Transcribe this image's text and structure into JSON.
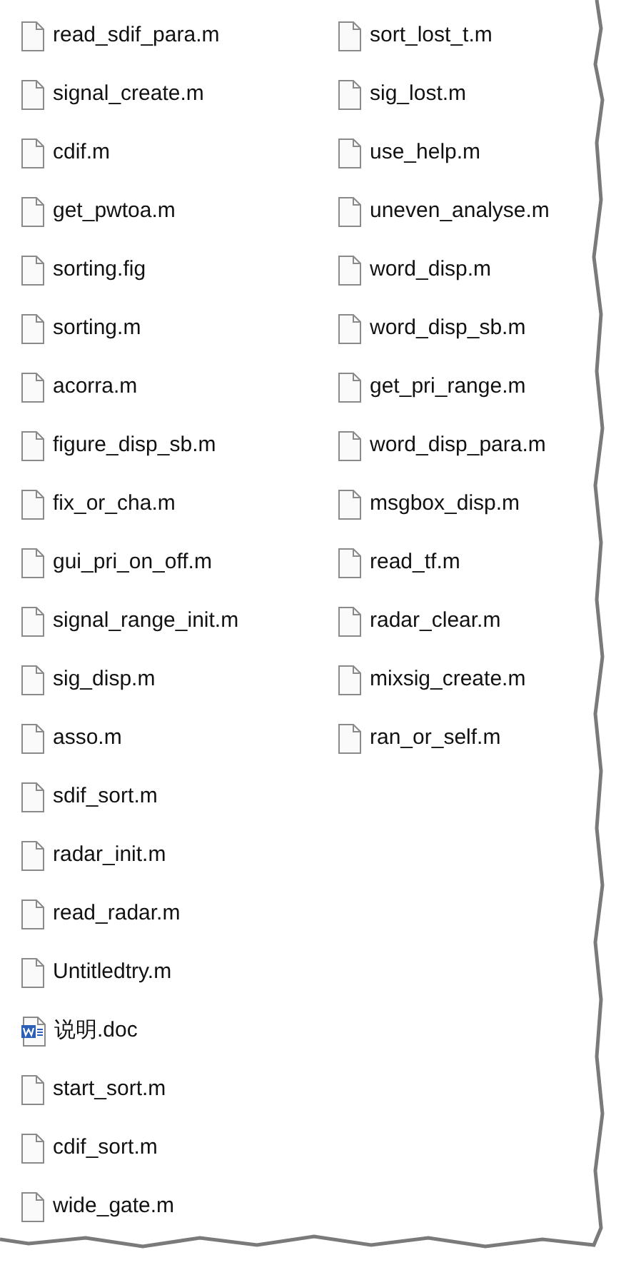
{
  "columns": [
    [
      {
        "name": "read_sdif_para.m",
        "kind": "file"
      },
      {
        "name": "signal_create.m",
        "kind": "file"
      },
      {
        "name": "cdif.m",
        "kind": "file"
      },
      {
        "name": "get_pwtoa.m",
        "kind": "file"
      },
      {
        "name": "sorting.fig",
        "kind": "file"
      },
      {
        "name": "sorting.m",
        "kind": "file"
      },
      {
        "name": "acorra.m",
        "kind": "file"
      },
      {
        "name": "figure_disp_sb.m",
        "kind": "file"
      },
      {
        "name": "fix_or_cha.m",
        "kind": "file"
      },
      {
        "name": "gui_pri_on_off.m",
        "kind": "file"
      },
      {
        "name": "signal_range_init.m",
        "kind": "file"
      },
      {
        "name": "sig_disp.m",
        "kind": "file"
      },
      {
        "name": "asso.m",
        "kind": "file"
      },
      {
        "name": "sdif_sort.m",
        "kind": "file"
      },
      {
        "name": "radar_init.m",
        "kind": "file"
      },
      {
        "name": "read_radar.m",
        "kind": "file"
      },
      {
        "name": "Untitledtry.m",
        "kind": "file"
      },
      {
        "name": "说明.doc",
        "kind": "word"
      },
      {
        "name": "start_sort.m",
        "kind": "file"
      },
      {
        "name": "cdif_sort.m",
        "kind": "file"
      },
      {
        "name": "wide_gate.m",
        "kind": "file"
      }
    ],
    [
      {
        "name": "sort_lost_t.m",
        "kind": "file"
      },
      {
        "name": "sig_lost.m",
        "kind": "file"
      },
      {
        "name": "use_help.m",
        "kind": "file"
      },
      {
        "name": "uneven_analyse.m",
        "kind": "file"
      },
      {
        "name": "word_disp.m",
        "kind": "file"
      },
      {
        "name": "word_disp_sb.m",
        "kind": "file"
      },
      {
        "name": "get_pri_range.m",
        "kind": "file"
      },
      {
        "name": "word_disp_para.m",
        "kind": "file"
      },
      {
        "name": "msgbox_disp.m",
        "kind": "file"
      },
      {
        "name": "read_tf.m",
        "kind": "file"
      },
      {
        "name": "radar_clear.m",
        "kind": "file"
      },
      {
        "name": "mixsig_create.m",
        "kind": "file"
      },
      {
        "name": "ran_or_self.m",
        "kind": "file"
      }
    ]
  ]
}
